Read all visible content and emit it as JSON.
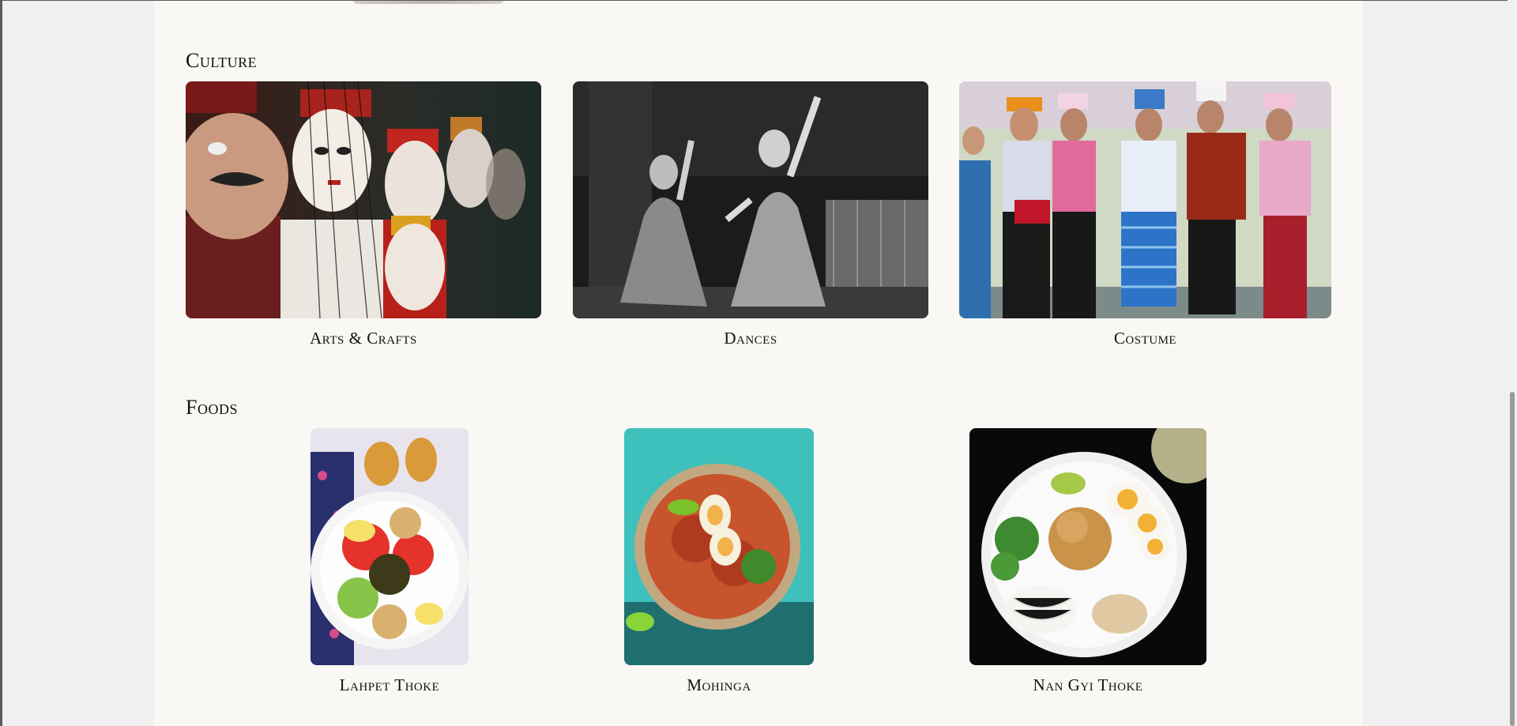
{
  "culture": {
    "heading": "Culture",
    "items": [
      {
        "caption": "Arts & Crafts"
      },
      {
        "caption": "Dances"
      },
      {
        "caption": "Costume"
      }
    ]
  },
  "foods": {
    "heading": "Foods",
    "items": [
      {
        "caption": "Lahpet Thoke"
      },
      {
        "caption": "Mohinga"
      },
      {
        "caption": "Nan Gyi Thoke"
      }
    ]
  },
  "colors": {
    "page_background": "#faf8f4",
    "outer_background": "#f0f0f0",
    "text": "#111111"
  }
}
